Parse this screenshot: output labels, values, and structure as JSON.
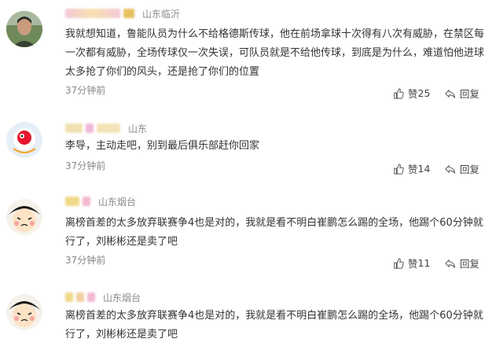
{
  "comments": [
    {
      "location": "山东临沂",
      "text": "我就想知道，鲁能队员为什么不给格德斯传球，他在前场拿球十次得有八次有威胁，在禁区每一次都有威胁，全场传球仅一次失误，可队员就是不给他传球，到底是为什么，难道怕他进球太多抢了你们的风头，还是抢了你们的位置",
      "time": "37分钟前",
      "likes": "25",
      "like_label": "赞",
      "reply_label": "回复"
    },
    {
      "location": "山东",
      "text": "李导，主动走吧，别到最后俱乐部赶你回家",
      "time": "37分钟前",
      "likes": "14",
      "like_label": "赞",
      "reply_label": "回复"
    },
    {
      "location": "山东烟台",
      "text": "离榜首差的太多放弃联赛争4也是对的，我就是看不明白崔鹏怎么踢的全场，他踢个60分钟就行了，刘彬彬还是卖了吧",
      "time": "37分钟前",
      "likes": "11",
      "like_label": "赞",
      "reply_label": "回复"
    },
    {
      "location": "山东烟台",
      "text": "离榜首差的太多放弃联赛争4也是对的，我就是看不明白崔鹏怎么踢的全场，他踢个60分钟就行了，刘彬彬还是卖了吧"
    }
  ],
  "colors": {
    "text": "#333333",
    "meta": "#888888",
    "location": "#8a8a8a"
  },
  "icons": {
    "like": "thumbs-up-icon",
    "reply": "reply-arrow-icon"
  }
}
